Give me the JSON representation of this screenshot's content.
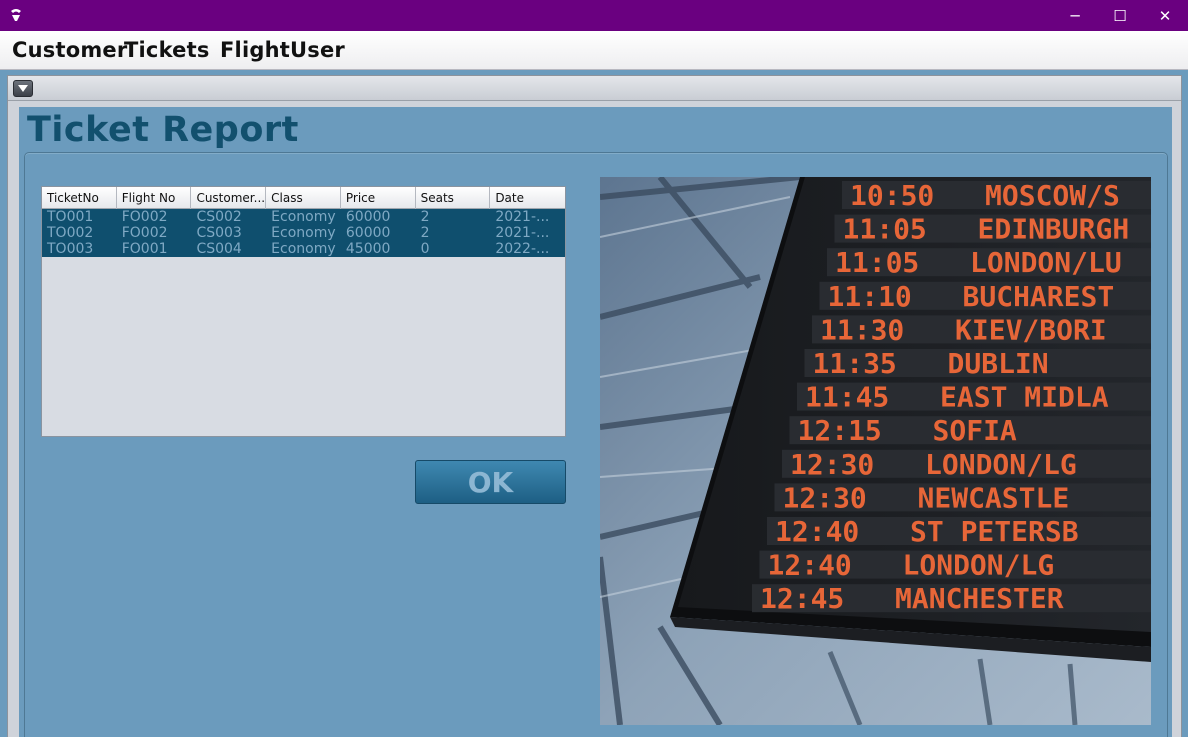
{
  "window": {
    "controls": [
      "─",
      "☐",
      "✕"
    ]
  },
  "menu": {
    "items": [
      "Customer",
      "Tickets",
      "Flight",
      "User"
    ]
  },
  "panel": {
    "title": "Ticket Report"
  },
  "table": {
    "columns": [
      "TicketNo",
      "Flight No",
      "Customer...",
      "Class",
      "Price",
      "Seats",
      "Date"
    ],
    "rows": [
      [
        "TO001",
        "FO002",
        "CS002",
        "Economy",
        "60000",
        "2",
        "2021-..."
      ],
      [
        "TO002",
        "FO002",
        "CS003",
        "Economy",
        "60000",
        "2",
        "2021-..."
      ],
      [
        "TO003",
        "FO001",
        "CS004",
        "Economy",
        "45000",
        "0",
        "2022-..."
      ]
    ]
  },
  "ok_button": {
    "label": "OK"
  },
  "board": {
    "rows": [
      [
        "10:50",
        "MOSCOW/S"
      ],
      [
        "11:05",
        "EDINBURGH"
      ],
      [
        "11:05",
        "LONDON/LU"
      ],
      [
        "11:10",
        "BUCHAREST"
      ],
      [
        "11:30",
        "KIEV/BORI"
      ],
      [
        "11:35",
        "DUBLIN"
      ],
      [
        "11:45",
        "EAST MIDLA"
      ],
      [
        "12:15",
        "SOFIA"
      ],
      [
        "12:30",
        "LONDON/LG"
      ],
      [
        "12:30",
        "NEWCASTLE"
      ],
      [
        "12:40",
        "ST PETERSB"
      ],
      [
        "12:40",
        "LONDON/LG"
      ],
      [
        "12:45",
        "MANCHESTER"
      ]
    ]
  },
  "colors": {
    "titlebar": "#6a0080",
    "content_bg": "#6b9bbd",
    "title_text": "#12506e",
    "selected_row": "#0f4f6e"
  }
}
